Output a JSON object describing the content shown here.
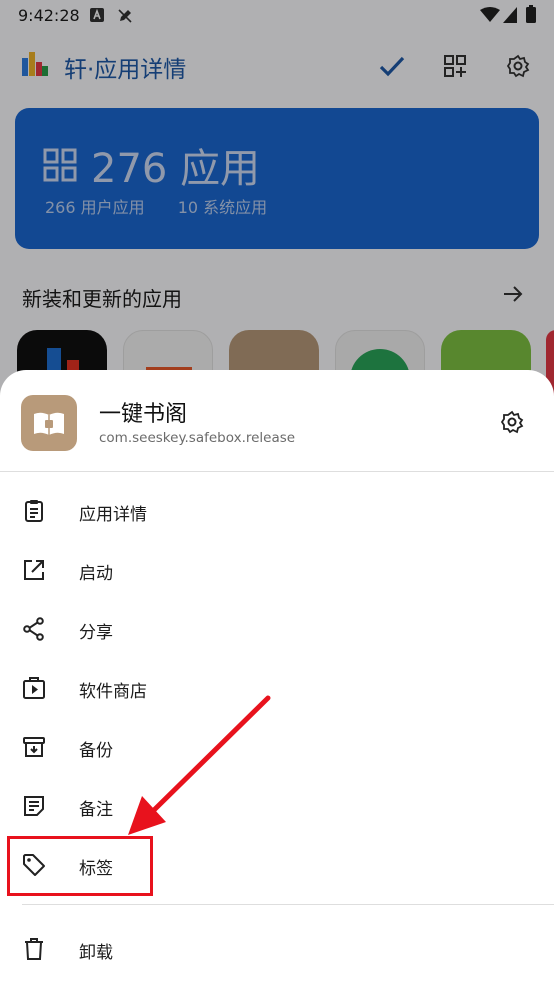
{
  "status_bar": {
    "time": "9:42:28"
  },
  "app_bar": {
    "title": "轩·应用详情"
  },
  "summary": {
    "count_label": "276 应用",
    "user_apps": "266 用户应用",
    "system_apps": "10 系统应用"
  },
  "recent": {
    "title": "新装和更新的应用"
  },
  "sheet": {
    "app_name": "一键书阁",
    "package": "com.seeskey.safebox.release",
    "items": [
      {
        "label": "应用详情",
        "icon": "clipboard-icon"
      },
      {
        "label": "启动",
        "icon": "open-external-icon"
      },
      {
        "label": "分享",
        "icon": "share-icon"
      },
      {
        "label": "软件商店",
        "icon": "store-icon"
      },
      {
        "label": "备份",
        "icon": "archive-icon"
      },
      {
        "label": "备注",
        "icon": "note-icon"
      },
      {
        "label": "标签",
        "icon": "tag-icon"
      },
      {
        "label": "卸载",
        "icon": "trash-icon"
      }
    ]
  },
  "colors": {
    "accent": "#1b67d2",
    "annotation": "#e8121d"
  }
}
